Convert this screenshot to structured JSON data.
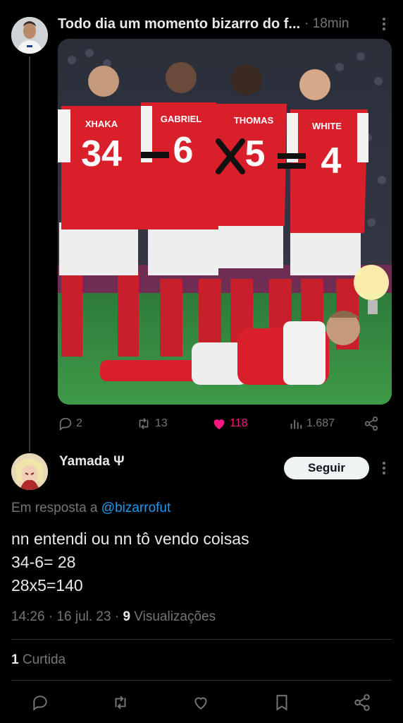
{
  "original_tweet": {
    "title": "Todo dia um momento bizarro do f...",
    "time": "· 18min",
    "media": {
      "shirts": [
        {
          "name": "XHAKA",
          "number": "34"
        },
        {
          "name": "GABRIEL",
          "number": "6"
        },
        {
          "name": "THOMAS",
          "number": "5"
        },
        {
          "name": "WHITE",
          "number": "4"
        }
      ],
      "ops": [
        "-",
        "×",
        "="
      ]
    },
    "stats": {
      "replies": "2",
      "retweets": "13",
      "likes": "118",
      "views": "1.687"
    }
  },
  "reply": {
    "name": "Yamada Ψ",
    "follow_label": "Seguir",
    "reply_prefix": "Em resposta a",
    "reply_handle": "@bizarrofut",
    "lines": [
      "nn entendi ou nn tô vendo coisas",
      "34-6= 28",
      "28x5=140"
    ],
    "meta_time": "14:26 · 16 jul. 23 · ",
    "meta_views_count": "9",
    "meta_views_label": " Visualizações",
    "likes_count": "1",
    "likes_label": " Curtida"
  },
  "icons": {
    "reply": "reply-icon",
    "retweet": "retweet-icon",
    "like": "heart-icon",
    "views": "views-icon",
    "share": "share-icon",
    "bookmark": "bookmark-icon",
    "more": "more-icon"
  },
  "colors": {
    "accent": "#1d9bf0",
    "like": "#f91880",
    "muted": "#71767b",
    "shirt_red": "#d81f2a"
  }
}
